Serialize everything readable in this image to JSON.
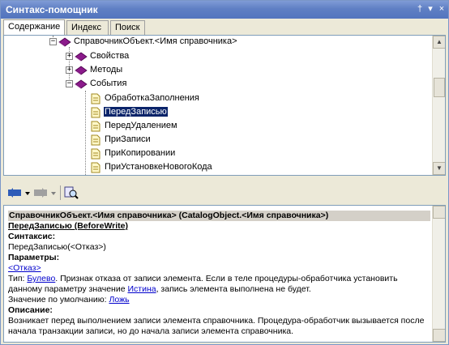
{
  "window": {
    "title": "Синтакс-помощник"
  },
  "titlebar_buttons": {
    "pin": "†",
    "menu": "▾",
    "close": "×"
  },
  "tabs": [
    {
      "label": "Содержание",
      "active": true
    },
    {
      "label": "Индекс",
      "active": false
    },
    {
      "label": "Поиск",
      "active": false
    }
  ],
  "tree": {
    "root": "СправочникОбъект.<Имя справочника>",
    "groups": [
      "Свойства",
      "Методы",
      "События"
    ],
    "events": [
      "ОбработкаЗаполнения",
      "ПередЗаписью",
      "ПередУдалением",
      "ПриЗаписи",
      "ПриКопировании",
      "ПриУстановкеНовогоКода"
    ],
    "selected": "ПередЗаписью"
  },
  "doc": {
    "heading": "СправочникОбъект.<Имя справочника> (CatalogObject.<Имя справочника>)",
    "method_title": "ПередЗаписью (BeforeWrite)",
    "syntax_label": "Синтаксис:",
    "syntax": "ПередЗаписью(<Отказ>)",
    "params_label": "Параметры:",
    "param_name": "<Отказ>",
    "type_prefix": "Тип: ",
    "type_link": "Булево",
    "type_text_1": ". Признак отказа от записи элемента. Если в теле процедуры-обработчика установить",
    "type_text_2": "данному параметру значение ",
    "true_link": "Истина",
    "type_text_3": ", запись элемента выполнена не будет.",
    "default_prefix": "Значение по умолчанию: ",
    "default_link": "Ложь",
    "desc_label": "Описание:",
    "description": "Возникает перед выполнением записи элемента справочника. Процедура-обработчик вызывается после начала транзакции записи, но до начала записи элемента справочника."
  }
}
